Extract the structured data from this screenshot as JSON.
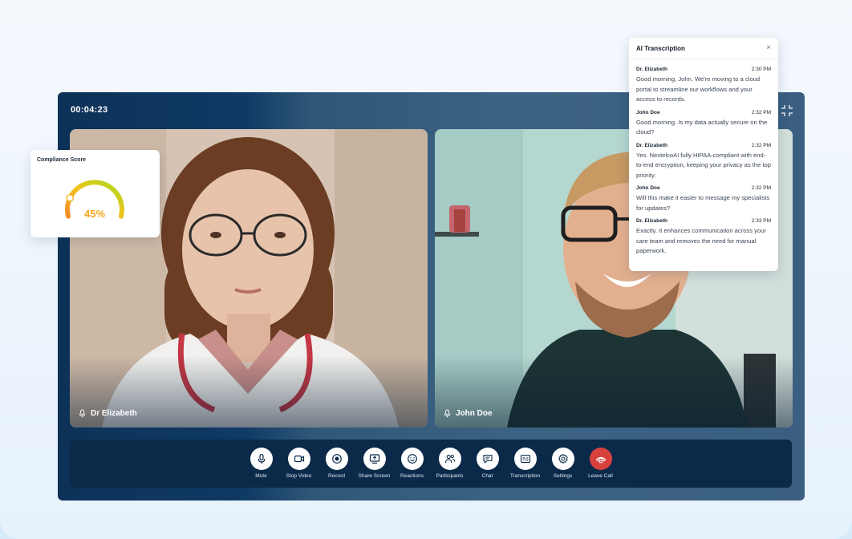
{
  "call": {
    "timer": "00:04:23"
  },
  "participants": [
    {
      "name": "Dr Elizabeth"
    },
    {
      "name": "John Doe"
    }
  ],
  "compliance": {
    "title": "Compliance Score",
    "value_text": "45%",
    "value": 45,
    "colors": {
      "start": "#f58a2a",
      "mid": "#f2c21d",
      "end": "#a6dc1c"
    }
  },
  "transcription": {
    "title": "AI Transcription",
    "close_icon": "×",
    "messages": [
      {
        "speaker": "Dr. Elizabeth",
        "time": "2:30 PM",
        "text": "Good morning, John. We're moving to a cloud portal to streamline our workflows and your access to records."
      },
      {
        "speaker": "John Doe",
        "time": "2:32 PM",
        "text": "Good morning. Is my data actually secure on the cloud?"
      },
      {
        "speaker": "Dr. Elizabeth",
        "time": "2:32 PM",
        "text": "Yes. NextelcoAI fully HIPAA-compliant with end-to-end encryption, keeping your privacy as the top priority."
      },
      {
        "speaker": "John Doe",
        "time": "2:32 PM",
        "text": "Will this make it easier to message my specialists for updates?"
      },
      {
        "speaker": "Dr. Elizabeth",
        "time": "2:33 PM",
        "text": "Exactly. It enhances communication across your care team and removes the need for manual paperwork."
      }
    ]
  },
  "controls": [
    {
      "label": "Mute",
      "icon": "microphone-icon"
    },
    {
      "label": "Stop Video",
      "icon": "video-camera-icon"
    },
    {
      "label": "Record",
      "icon": "record-icon"
    },
    {
      "label": "Share Screen",
      "icon": "share-screen-icon"
    },
    {
      "label": "Reactions",
      "icon": "smiley-icon"
    },
    {
      "label": "Participants",
      "icon": "participants-icon"
    },
    {
      "label": "Chat",
      "icon": "chat-icon"
    },
    {
      "label": "Transcription",
      "icon": "transcription-icon"
    },
    {
      "label": "Settings",
      "icon": "gear-icon"
    },
    {
      "label": "Leave Call",
      "icon": "phone-hangup-icon"
    }
  ]
}
